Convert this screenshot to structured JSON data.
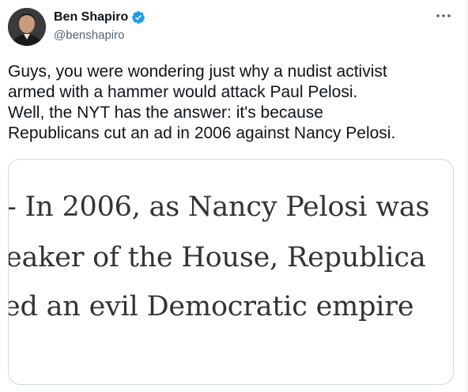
{
  "author": {
    "display_name": "Ben Shapiro",
    "handle": "@benshapiro",
    "verified_icon": "verified-badge-icon",
    "verified_color": "#1d9bf0"
  },
  "tweet": {
    "text": "Guys, you were wondering just why a nudist activist\narmed with a hammer would attack Paul Pelosi.\nWell, the NYT has the answer: it's because\nRepublicans cut an ad in 2006 against Nancy Pelosi."
  },
  "media": {
    "lines": [
      "- In 2006, as Nancy Pelosi was",
      "eaker of the House, Republica",
      "ed an evil Democratic empire"
    ]
  },
  "menu": {
    "icon": "more-horizontal-icon"
  }
}
